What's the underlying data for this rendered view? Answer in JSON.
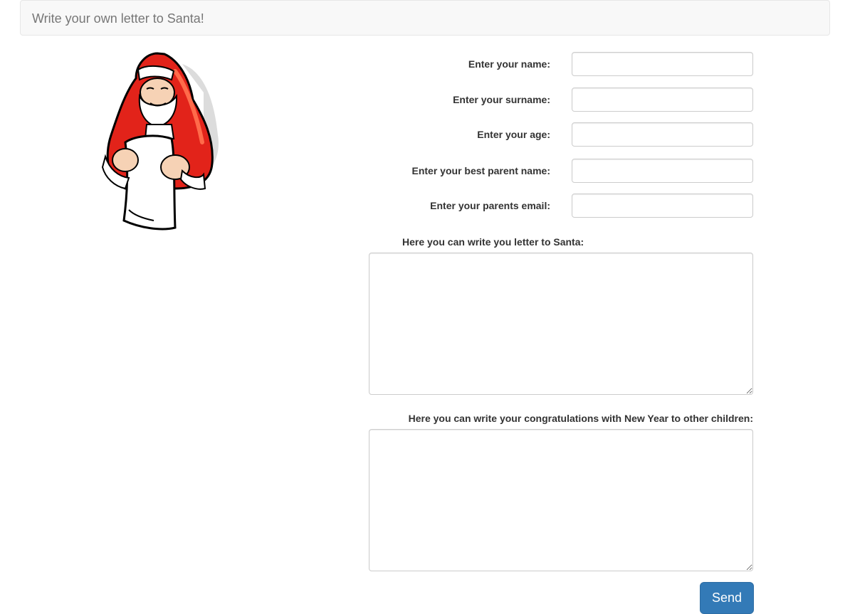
{
  "navbar": {
    "brand": "Write your own letter to Santa!"
  },
  "form": {
    "name_label": "Enter your name:",
    "surname_label": "Enter your surname:",
    "age_label": "Enter your age:",
    "parent_name_label": "Enter your best parent name:",
    "parent_email_label": "Enter your parents email:",
    "letter_label": "Here you can write you letter to Santa:",
    "congrats_label": "Here you can write your congratulations with New Year to other children:",
    "name_value": "",
    "surname_value": "",
    "age_value": "",
    "parent_name_value": "",
    "parent_email_value": "",
    "send_label": "Send"
  },
  "colors": {
    "santa_red": "#e2231a",
    "button_blue": "#337ab7",
    "navbar_bg": "#f8f8f8"
  }
}
